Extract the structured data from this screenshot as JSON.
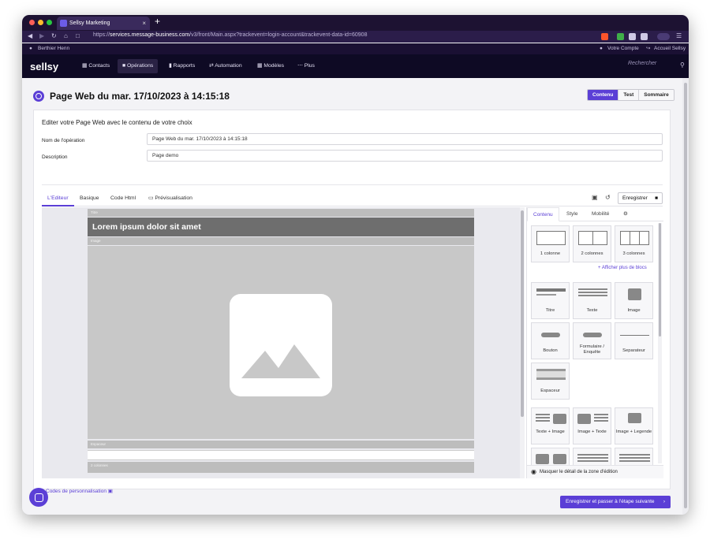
{
  "browser": {
    "tab_title": "Sellsy Marketing",
    "tab_close": "×",
    "new_tab": "+",
    "url_prefix": "https://",
    "url_host": "services.message-business.com",
    "url_path": "/v3/front/Main.aspx?trackevent=login-account&trackevent-data-id=60908"
  },
  "userbar": {
    "user": "Berthier Henn",
    "account": "Votre Compte",
    "home": "Accueil Sellsy"
  },
  "appnav": {
    "logo": "sellsy",
    "items": [
      "Contacts",
      "Opérations",
      "Rapports",
      "Automation",
      "Modèles",
      "Plus"
    ],
    "active_index": 1,
    "search_placeholder": "Rechercher"
  },
  "page": {
    "title": "Page Web du mar. 17/10/2023 à 14:15:18",
    "top_buttons": [
      "Contenu",
      "Test",
      "Sommaire"
    ],
    "card_title": "Editer votre Page Web avec le contenu de votre choix",
    "name_label": "Nom de l'opération",
    "name_value": "Page Web du mar. 17/10/2023 à 14:15:18",
    "desc_label": "Description",
    "desc_value": "Page demo"
  },
  "editor": {
    "tabs": [
      "L'Editeur",
      "Basique",
      "Code Html",
      "Prévisualisation"
    ],
    "save_label": "Enregistrer",
    "blocks": {
      "title_label": "Titre",
      "hero_text": "Lorem ipsum dolor sit amet",
      "image_label": "Image",
      "spacer_label": "Espaceur",
      "columns_label": "2 colonnes"
    }
  },
  "panel": {
    "tabs": [
      "Contenu",
      "Style",
      "Mobilité"
    ],
    "layouts": [
      "1 colonne",
      "2 colonnes",
      "3 colonnes"
    ],
    "more_blocks": "+ Afficher plus de blocs",
    "elements": [
      "Titre",
      "Texte",
      "Image",
      "Bouton",
      "Formulaire / Enquête",
      "Separateur",
      "Espaceur"
    ],
    "combos": [
      "Texte + Image",
      "Image + Texte",
      "Image + Legende"
    ],
    "footer": "Masquer le détail de la zone d'édition"
  },
  "footer": {
    "codes_link": "Codes de personnalisation",
    "next_button": "Enregistrer et passer à l'étape suivante"
  },
  "colors": {
    "accent": "#5b3fd6",
    "nav_bg": "#0e0a24"
  }
}
